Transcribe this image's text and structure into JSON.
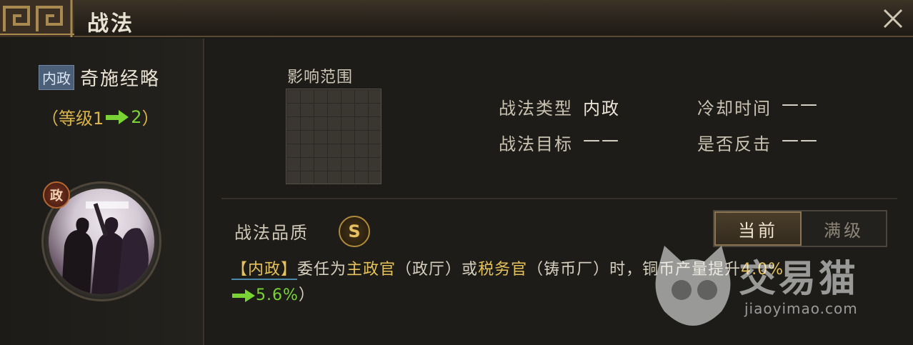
{
  "window": {
    "title": "战法"
  },
  "skill": {
    "type_tag": "内政",
    "name": "奇施经略",
    "level_open": "（等级1",
    "level_to": "2",
    "level_close": "）",
    "portrait_badge": "政"
  },
  "range": {
    "label": "影响范围"
  },
  "attributes": {
    "type_label": "战法类型",
    "type_value": "内政",
    "cooldown_label": "冷却时间",
    "cooldown_value": "——",
    "target_label": "战法目标",
    "target_value": "——",
    "counter_label": "是否反击",
    "counter_value": "——"
  },
  "quality": {
    "label": "战法品质",
    "grade": "S"
  },
  "toggle": {
    "current": "当前",
    "max": "满级",
    "selected": "current"
  },
  "description": {
    "tag": "【内政】",
    "t1": "委任为",
    "h1": "主政官",
    "t2": "（政厅）或",
    "h2": "税务官",
    "t3": "（铸币厂）时，铜币产量提升",
    "from": "4.0%",
    "to": "5.6%",
    "close": "）"
  },
  "watermark": {
    "brand": "交易猫",
    "url": "jiaoyimao.com"
  },
  "colors": {
    "accent_gold": "#e6c25a",
    "accent_green": "#7ad334",
    "tag_blue": "#4b5f78"
  }
}
